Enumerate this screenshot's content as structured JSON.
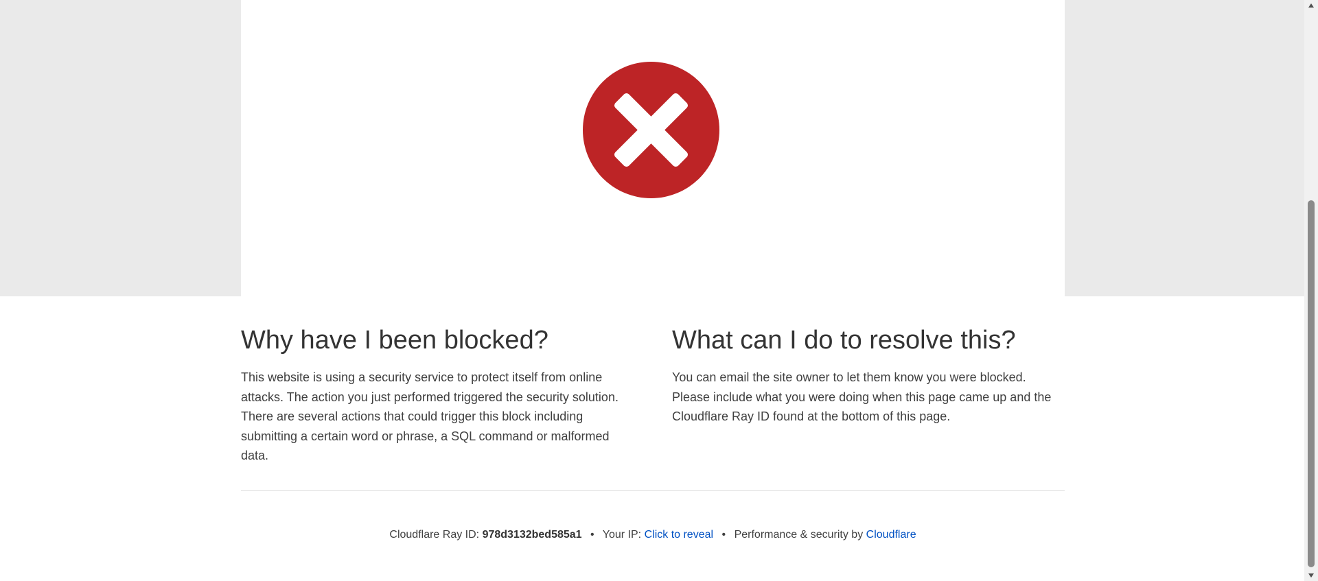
{
  "hero": {
    "icon": "error-x-icon",
    "icon_color": "#bd2426"
  },
  "why": {
    "heading": "Why have I been blocked?",
    "body": "This website is using a security service to protect itself from online attacks. The action you just performed triggered the security solution. There are several actions that could trigger this block including submitting a certain word or phrase, a SQL command or malformed data."
  },
  "resolve": {
    "heading": "What can I do to resolve this?",
    "body": "You can email the site owner to let them know you were blocked. Please include what you were doing when this page came up and the Cloudflare Ray ID found at the bottom of this page."
  },
  "footer": {
    "ray_label": "Cloudflare Ray ID:",
    "ray_id": "978d3132bed585a1",
    "separator": "•",
    "ip_label": "Your IP:",
    "ip_link": "Click to reveal",
    "perf_label": "Performance & security by",
    "cloudflare_link": "Cloudflare",
    "link_color": "#0051c3"
  }
}
